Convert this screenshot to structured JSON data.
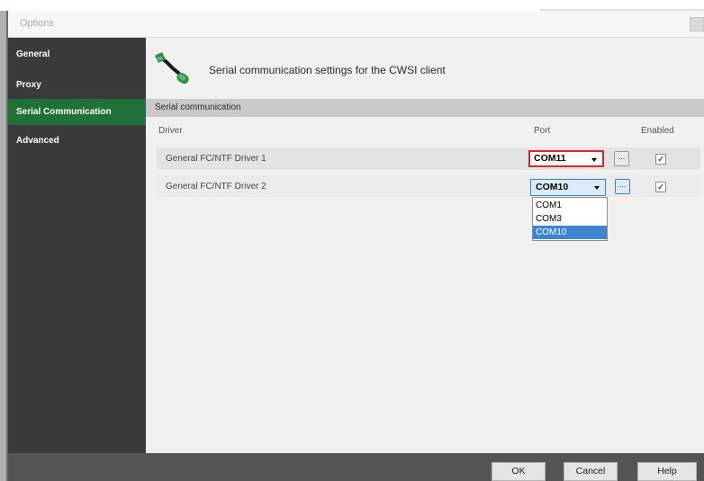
{
  "window": {
    "title": "Options"
  },
  "sidebar": {
    "items": [
      {
        "label": "General",
        "selected": false
      },
      {
        "label": "Proxy",
        "selected": false
      },
      {
        "label": "Serial Communication",
        "selected": true
      },
      {
        "label": "Advanced",
        "selected": false
      }
    ]
  },
  "header": {
    "title": "Serial communication settings for the CWSI client",
    "icon": "serial-cable-icon"
  },
  "section": {
    "label": "Serial communication"
  },
  "table": {
    "columns": {
      "driver": "Driver",
      "port": "Port",
      "enabled": "Enabled"
    },
    "rows": [
      {
        "driver": "General FC/NTF Driver 1",
        "port": "COM11",
        "enabled": true,
        "enabled_mark": "✓",
        "button": "..."
      },
      {
        "driver": "General FC/NTF Driver 2",
        "port": "COM10",
        "enabled": true,
        "enabled_mark": "✓",
        "button": "..."
      }
    ]
  },
  "dropdown": {
    "options": [
      "COM1",
      "COM3",
      "COM10"
    ],
    "selected": "COM10"
  },
  "footer": {
    "ok": "OK",
    "cancel": "Cancel",
    "help": "Help"
  },
  "colors": {
    "sidebar_bg": "#3a3a3a",
    "selected_nav": "#21703a",
    "highlight_border": "#d8262c",
    "selection_blue": "#3c85d2"
  }
}
